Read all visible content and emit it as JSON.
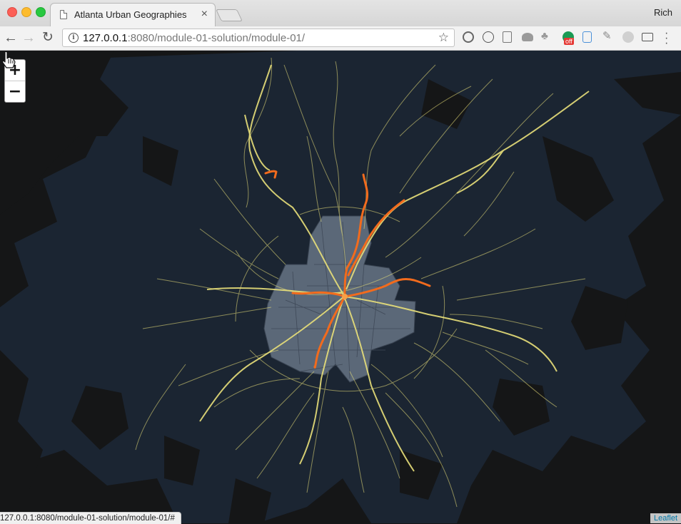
{
  "browser": {
    "tab_title": "Atlanta Urban Geographies",
    "tab_close": "×",
    "profile_name": "Rich",
    "url_host": "127.0.0.1",
    "url_rest": ":8080/module-01-solution/module-01/",
    "status_url": "127.0.0.1:8080/module-01-solution/module-01/#",
    "extension_badge": "off"
  },
  "nav": {
    "back": "←",
    "forward": "→",
    "reload": "↻",
    "bookmark": "☆"
  },
  "map": {
    "zoom_in": "+",
    "zoom_out": "−",
    "attribution": "Leaflet"
  },
  "colors": {
    "map_background": "#151617",
    "urban_area": "#1b2532",
    "city_blocks": "#5b6878",
    "bus_routes": "#e9e07a",
    "rail_lines": "#f26b1d",
    "link": "#0078a8"
  },
  "icons": [
    "page-icon",
    "close-icon",
    "back-icon",
    "forward-icon",
    "reload-icon",
    "info-icon",
    "star-icon",
    "menu-icon",
    "cursor-hand-icon"
  ]
}
